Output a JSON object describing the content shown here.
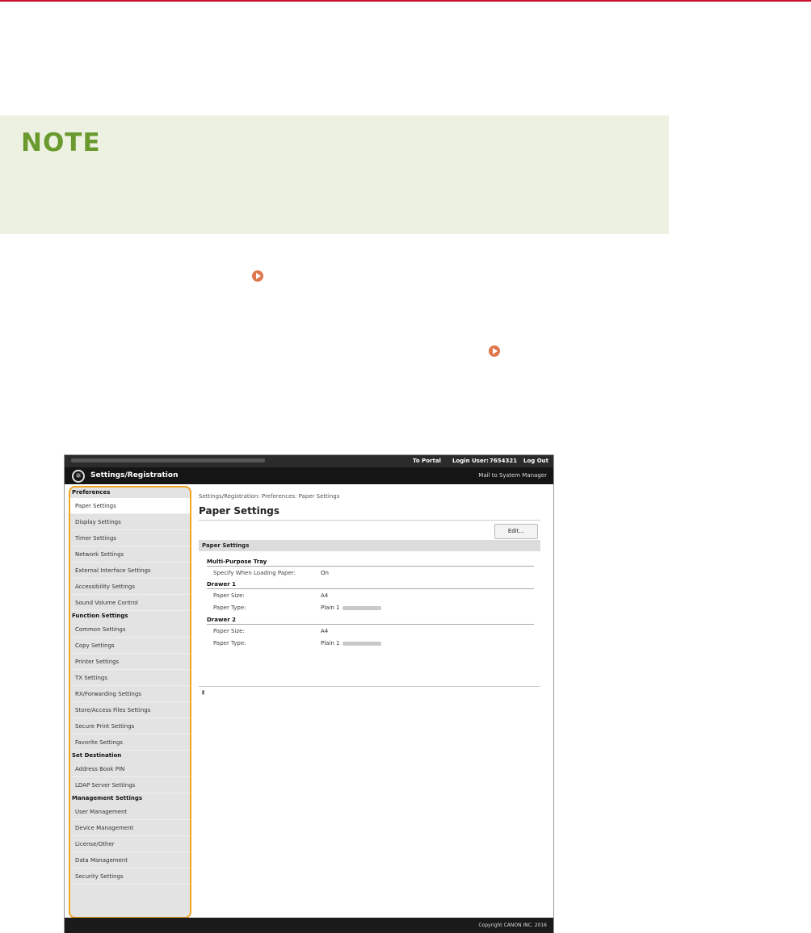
{
  "note": {
    "title": "NOTE"
  },
  "screenshot": {
    "topbar": {
      "to_portal": "To Portal",
      "login_label": "Login User:",
      "user_id": "7654321",
      "logout": "Log Out"
    },
    "title": "Settings/Registration",
    "mail_link": "Mail to System Manager",
    "sidebar": {
      "groups": [
        {
          "heading": "Preferences",
          "items": [
            "Paper Settings",
            "Display Settings",
            "Timer Settings",
            "Network Settings",
            "External Interface Settings",
            "Accessibility Settings",
            "Sound Volume Control"
          ]
        },
        {
          "heading": "Function Settings",
          "items": [
            "Common Settings",
            "Copy Settings",
            "Printer Settings",
            "TX Settings",
            "RX/Forwarding Settings",
            "Store/Access Files Settings",
            "Secure Print Settings",
            "Favorite Settings"
          ]
        },
        {
          "heading": "Set Destination",
          "items": [
            "Address Book PIN",
            "LDAP Server Settings"
          ]
        },
        {
          "heading": "Management Settings",
          "items": [
            "User Management",
            "Device Management",
            "License/Other",
            "Data Management",
            "Security Settings"
          ]
        }
      ],
      "selected": "Paper Settings"
    },
    "main": {
      "breadcrumb": "Settings/Registration: Preferences: Paper Settings",
      "title": "Paper Settings",
      "edit_button": "Edit...",
      "section": "Paper Settings",
      "multi_purpose": {
        "heading": "Multi-Purpose Tray",
        "specify_label": "Specify When Loading Paper:",
        "specify_value": "On"
      },
      "drawer1": {
        "heading": "Drawer 1",
        "size_label": "Paper Size:",
        "size_value": "A4",
        "type_label": "Paper Type:",
        "type_value": "Plain 1"
      },
      "drawer2": {
        "heading": "Drawer 2",
        "size_label": "Paper Size:",
        "size_value": "A4",
        "type_label": "Paper Type:",
        "type_value": "Plain 1"
      },
      "top_icon": "⇞"
    },
    "footer": "Copyright CANON INC. 2016"
  }
}
